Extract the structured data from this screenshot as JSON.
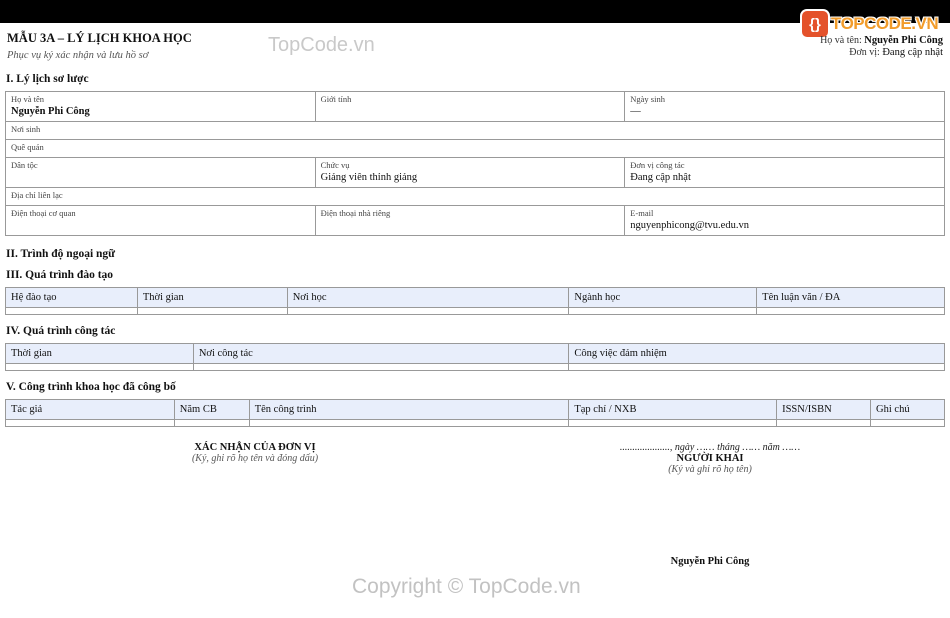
{
  "watermark": {
    "top": "TopCode.vn",
    "bottom": "Copyright © TopCode.vn"
  },
  "logo": {
    "mark": "{}",
    "text": "TOPCODE.VN"
  },
  "header": {
    "title": "MẪU 3A – LÝ LỊCH KHOA HỌC",
    "subtitle": "Phục vụ ký xác nhận và lưu hồ sơ",
    "name_label": "Họ và tên:",
    "name_value": "Nguyễn Phi Công",
    "unit_label": "Đơn vị:",
    "unit_value": "Đang cập nhật"
  },
  "section1": {
    "title": "I. Lý lịch sơ lược",
    "fields": {
      "fullname": {
        "label": "Họ và tên",
        "value": "Nguyễn Phi Công"
      },
      "gender": {
        "label": "Giới tính",
        "value": ""
      },
      "dob": {
        "label": "Ngày sinh",
        "value": "—"
      },
      "birthplace": {
        "label": "Nơi sinh",
        "value": ""
      },
      "hometown": {
        "label": "Quê quán",
        "value": ""
      },
      "ethnicity": {
        "label": "Dân tộc",
        "value": ""
      },
      "position": {
        "label": "Chức vụ",
        "value": "Giảng viên thỉnh giảng"
      },
      "workplace": {
        "label": "Đơn vị công tác",
        "value": "Đang cập nhật"
      },
      "address": {
        "label": "Địa chỉ liên lạc",
        "value": ""
      },
      "office_phone": {
        "label": "Điện thoại cơ quan",
        "value": ""
      },
      "home_phone": {
        "label": "Điện thoại nhà riêng",
        "value": ""
      },
      "email": {
        "label": "E-mail",
        "value": "nguyenphicong@tvu.edu.vn"
      }
    }
  },
  "section2": {
    "title": "II. Trình độ ngoại ngữ"
  },
  "section3": {
    "title": "III. Quá trình đào tạo",
    "columns": [
      "Hệ đào tạo",
      "Thời gian",
      "Nơi học",
      "Ngành học",
      "Tên luận văn / ĐA"
    ]
  },
  "section4": {
    "title": "IV. Quá trình công tác",
    "columns": [
      "Thời gian",
      "Nơi công tác",
      "Công việc đảm nhiệm"
    ]
  },
  "section5": {
    "title": "V. Công trình khoa học đã công bố",
    "columns": [
      "Tác giả",
      "Năm CB",
      "Tên công trình",
      "Tạp chí / NXB",
      "ISSN/ISBN",
      "Ghi chú"
    ]
  },
  "signatures": {
    "left_title": "XÁC NHẬN CỦA ĐƠN VỊ",
    "left_note": "(Ký, ghi rõ họ tên và đóng dấu)",
    "date_line": "...................., ngày …… tháng …… năm ……",
    "right_title": "NGƯỜI KHAI",
    "right_note": "(Ký và ghi rõ họ tên)",
    "right_name": "Nguyễn Phi Công"
  }
}
